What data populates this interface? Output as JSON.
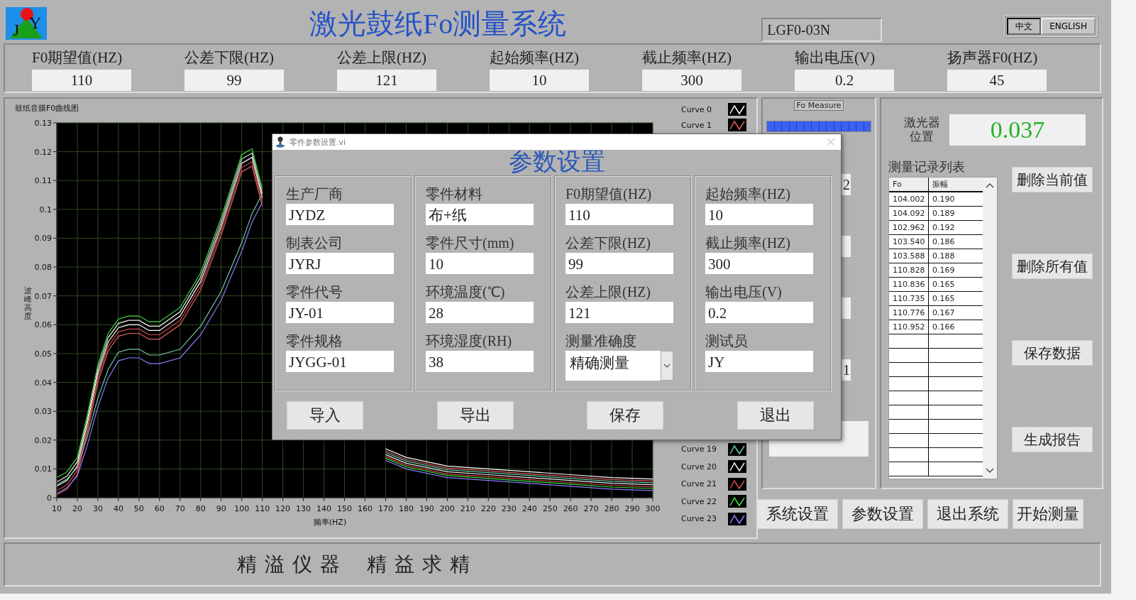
{
  "logo": {
    "letters": [
      "J",
      "Y"
    ]
  },
  "title": "激光鼓纸Fo测量系统",
  "model": "LGF0-03N",
  "language_buttons": [
    {
      "label": "中文",
      "selected": true
    },
    {
      "label": "ENGLISH",
      "selected": false
    }
  ],
  "parameters": [
    {
      "label": "F0期望值(HZ)",
      "value": "110"
    },
    {
      "label": "公差下限(HZ)",
      "value": "99"
    },
    {
      "label": "公差上限(HZ)",
      "value": "121"
    },
    {
      "label": "起始频率(HZ)",
      "value": "10"
    },
    {
      "label": "截止频率(HZ)",
      "value": "300"
    },
    {
      "label": "输出电压(V)",
      "value": "0.2"
    },
    {
      "label": "扬声器F0(HZ)",
      "value": "45"
    }
  ],
  "chart": {
    "title": "鼓纸音膜F0曲线图",
    "chart_data": {
      "type": "line",
      "xlabel": "频率(HZ)",
      "ylabel": "波峰高度",
      "grid": true,
      "x": [
        10,
        15,
        20,
        25,
        30,
        35,
        40,
        45,
        50,
        55,
        60,
        70,
        80,
        90,
        100,
        105,
        110,
        115,
        120,
        130,
        140,
        150,
        160,
        170,
        180,
        200,
        220,
        240,
        260,
        280,
        300
      ],
      "xlim": [
        10,
        300
      ],
      "ylim": [
        0,
        0.13
      ],
      "xticks": [
        10,
        20,
        30,
        40,
        50,
        60,
        70,
        80,
        90,
        100,
        110,
        120,
        130,
        140,
        150,
        160,
        170,
        180,
        190,
        200,
        210,
        220,
        230,
        240,
        250,
        260,
        270,
        280,
        290,
        300
      ],
      "yticks": [
        0,
        0.01,
        0.02,
        0.03,
        0.04,
        0.05,
        0.06,
        0.07,
        0.08,
        0.09,
        0.1,
        0.11,
        0.12,
        0.13
      ],
      "series": [
        {
          "name": "Curve 0",
          "color": "#ffffff",
          "values": [
            0.004,
            0.006,
            0.011,
            0.026,
            0.043,
            0.054,
            0.059,
            0.06,
            0.06,
            0.058,
            0.058,
            0.063,
            0.075,
            0.094,
            0.116,
            0.118,
            0.104,
            null,
            null,
            null,
            null,
            null,
            null,
            0.017,
            0.014,
            0.011,
            0.01,
            0.009,
            0.008,
            0.007,
            0.0065
          ]
        },
        {
          "name": "Curve 1",
          "color": "#e06060",
          "values": [
            0.001,
            0.003,
            0.008,
            0.023,
            0.04,
            0.051,
            0.056,
            0.057,
            0.057,
            0.055,
            0.055,
            0.06,
            0.072,
            0.091,
            0.113,
            0.115,
            0.101,
            null,
            null,
            null,
            null,
            null,
            null,
            0.0163,
            0.0133,
            0.0103,
            0.0093,
            0.0083,
            0.0073,
            0.0063,
            0.0058
          ]
        },
        {
          "name": "Curve 19",
          "color": "#70c8a8",
          "values": [
            0.0045,
            0.0065,
            0.0105,
            0.0215,
            0.0345,
            0.0445,
            0.0505,
            0.0515,
            0.0515,
            0.0495,
            0.0495,
            0.0515,
            0.0595,
            0.0715,
            0.0885,
            0.0985,
            0.1055,
            null,
            null,
            null,
            null,
            null,
            null,
            0.0157,
            0.0127,
            0.0097,
            0.0087,
            0.0077,
            0.0067,
            0.0057,
            0.0052
          ]
        },
        {
          "name": "Curve 20",
          "color": "#f0f0f0",
          "values": [
            0.0055,
            0.0075,
            0.0125,
            0.0275,
            0.0445,
            0.0555,
            0.0605,
            0.0615,
            0.0615,
            0.0595,
            0.0595,
            0.0645,
            0.0765,
            0.0955,
            0.1175,
            0.1195,
            0.1055,
            null,
            null,
            null,
            null,
            null,
            null,
            0.015,
            0.012,
            0.009,
            0.008,
            0.007,
            0.006,
            0.005,
            0.0045
          ]
        },
        {
          "name": "Curve 21",
          "color": "#d04848",
          "values": [
            0.0025,
            0.0045,
            0.0095,
            0.0245,
            0.0415,
            0.0525,
            0.0575,
            0.0585,
            0.0585,
            0.0565,
            0.0565,
            0.0615,
            0.0735,
            0.0925,
            0.1145,
            0.1165,
            0.1025,
            null,
            null,
            null,
            null,
            null,
            null,
            0.0143,
            0.0113,
            0.0083,
            0.0073,
            0.0063,
            0.0053,
            0.0043,
            0.0038
          ]
        },
        {
          "name": "Curve 22",
          "color": "#40e040",
          "values": [
            0.007,
            0.009,
            0.014,
            0.029,
            0.046,
            0.057,
            0.062,
            0.063,
            0.063,
            0.061,
            0.061,
            0.066,
            0.078,
            0.097,
            0.119,
            0.121,
            0.107,
            null,
            null,
            null,
            null,
            null,
            null,
            0.0137,
            0.0107,
            0.0077,
            0.0067,
            0.0057,
            0.0047,
            0.0037,
            0.0032
          ]
        },
        {
          "name": "Curve 23",
          "color": "#8c7cff",
          "values": [
            0.0015,
            0.0035,
            0.0075,
            0.0185,
            0.0315,
            0.0415,
            0.0475,
            0.0485,
            0.0485,
            0.0465,
            0.0465,
            0.0485,
            0.0565,
            0.0685,
            0.0855,
            0.0955,
            0.1025,
            null,
            null,
            null,
            null,
            null,
            null,
            0.013,
            0.01,
            0.007,
            0.006,
            0.005,
            0.004,
            0.003,
            0.0025
          ]
        }
      ]
    }
  },
  "measure_panel": {
    "label": "Fo Measure",
    "progress": {
      "level": 1
    },
    "items": [
      {
        "kind": "value",
        "text": "2"
      },
      {
        "kind": "box"
      },
      {
        "kind": "box"
      },
      {
        "kind": "value",
        "text": "1"
      },
      {
        "kind": "result"
      }
    ]
  },
  "laser": {
    "label": [
      "激光器",
      "位置"
    ],
    "value": "0.037"
  },
  "records": {
    "title": "测量记录列表",
    "columns": [
      "Fo",
      "振幅"
    ],
    "rows": [
      [
        "104.002",
        "0.190"
      ],
      [
        "104.092",
        "0.189"
      ],
      [
        "102.962",
        "0.192"
      ],
      [
        "103.540",
        "0.186"
      ],
      [
        "103.588",
        "0.188"
      ],
      [
        "110.828",
        "0.169"
      ],
      [
        "110.836",
        "0.165"
      ],
      [
        "110.735",
        "0.165"
      ],
      [
        "110.776",
        "0.167"
      ],
      [
        "110.952",
        "0.166"
      ]
    ]
  },
  "record_buttons": [
    "删除当前值",
    "删除所有值",
    "保存数据",
    "生成报告"
  ],
  "bottom_buttons": [
    "系统设置",
    "参数设置",
    "退出系统",
    "开始测量"
  ],
  "footer": "精 溢 仪 器    精 益 求 精",
  "dialog": {
    "title": "零件参数设置.vi",
    "heading": "参数设置",
    "columns": [
      [
        {
          "label": "生产厂商",
          "value": "JYDZ",
          "kind": "text"
        },
        {
          "label": "制表公司",
          "value": "JYRJ",
          "kind": "text"
        },
        {
          "label": "零件代号",
          "value": "JY-01",
          "kind": "text"
        },
        {
          "label": "零件规格",
          "value": "JYGG-01",
          "kind": "text"
        }
      ],
      [
        {
          "label": "零件材料",
          "value": "布+纸",
          "kind": "text"
        },
        {
          "label": "零件尺寸(mm)",
          "value": "10",
          "kind": "text"
        },
        {
          "label": "环境温度(℃)",
          "value": "28",
          "kind": "text"
        },
        {
          "label": "环境湿度(RH)",
          "value": "38",
          "kind": "text"
        }
      ],
      [
        {
          "label": "F0期望值(HZ)",
          "value": "110",
          "kind": "text"
        },
        {
          "label": "公差下限(HZ)",
          "value": "99",
          "kind": "text"
        },
        {
          "label": "公差上限(HZ)",
          "value": "121",
          "kind": "text"
        },
        {
          "label": "测量准确度",
          "value": "精确测量",
          "kind": "select"
        }
      ],
      [
        {
          "label": "起始频率(HZ)",
          "value": "10",
          "kind": "text"
        },
        {
          "label": "截止频率(HZ)",
          "value": "300",
          "kind": "text"
        },
        {
          "label": "输出电压(V)",
          "value": "0.2",
          "kind": "text"
        },
        {
          "label": "测试员",
          "value": "JY",
          "kind": "text"
        }
      ]
    ],
    "buttons": [
      "导入",
      "导出",
      "保存",
      "退出"
    ]
  }
}
